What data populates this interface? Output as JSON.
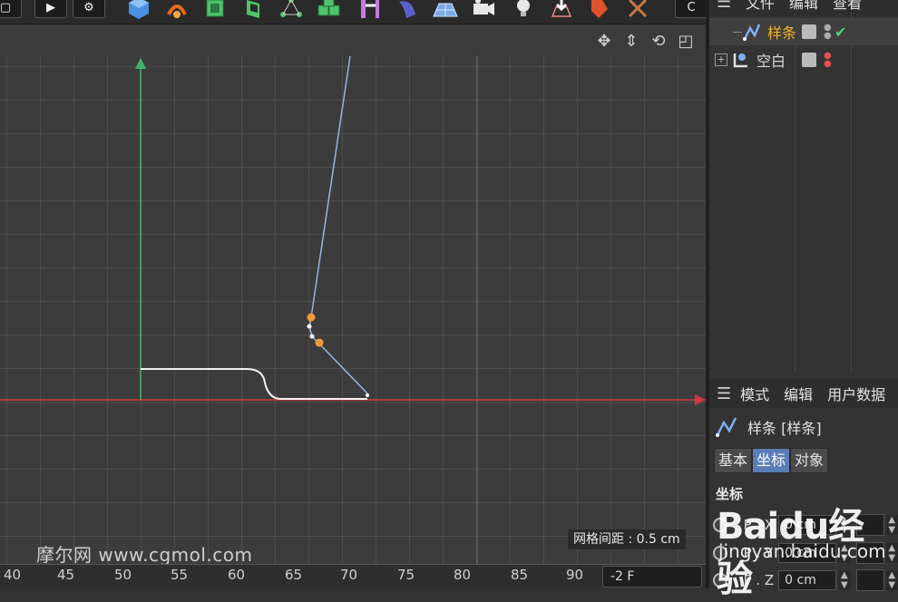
{
  "toolbar": {
    "icons": [
      "square-icon",
      "play-icon",
      "gear-icon",
      "cube-icon",
      "bend-icon",
      "cube-green-icon",
      "extrude-icon",
      "network-icon",
      "cubes-icon",
      "boole-icon",
      "deformer-icon",
      "floor-icon",
      "camera-icon",
      "light-icon",
      "render-icon",
      "tag-icon",
      "bone-icon",
      "c-icon"
    ]
  },
  "viewport": {
    "grid_info": "网格间距 : 0.5 cm",
    "watermark": "摩尔网 www.cgmol.com"
  },
  "timeline": {
    "ticks": [
      "40",
      "45",
      "50",
      "55",
      "60",
      "65",
      "70",
      "75",
      "80",
      "85",
      "90"
    ],
    "frame_value": "-2 F"
  },
  "object_manager": {
    "menu": [
      "文件",
      "编辑",
      "查看"
    ],
    "objects": [
      {
        "label": "样条",
        "selected": true,
        "color": "#f0b429"
      },
      {
        "label": "空白",
        "selected": false,
        "color": "#e0e0e0"
      }
    ]
  },
  "attributes": {
    "menu": [
      "模式",
      "编辑",
      "用户数据"
    ],
    "title": "样条 [样条]",
    "tabs": [
      "基本",
      "坐标",
      "对象"
    ],
    "active_tab": "坐标",
    "section": "坐标",
    "rows": [
      {
        "label": "P . X",
        "value": "0 cm"
      },
      {
        "label": "P . Y",
        "value": "0 cm"
      },
      {
        "label": "P . Z",
        "value": "0 cm"
      }
    ],
    "watermark_logo": "Baidu经验",
    "watermark_url": "jingyan.baidu.com"
  },
  "colors": {
    "accent": "#5b7db6",
    "axis_x": "#d0393b",
    "axis_y": "#3fb36b",
    "spline": "#9ab4dc",
    "point": "#f29a3a"
  }
}
